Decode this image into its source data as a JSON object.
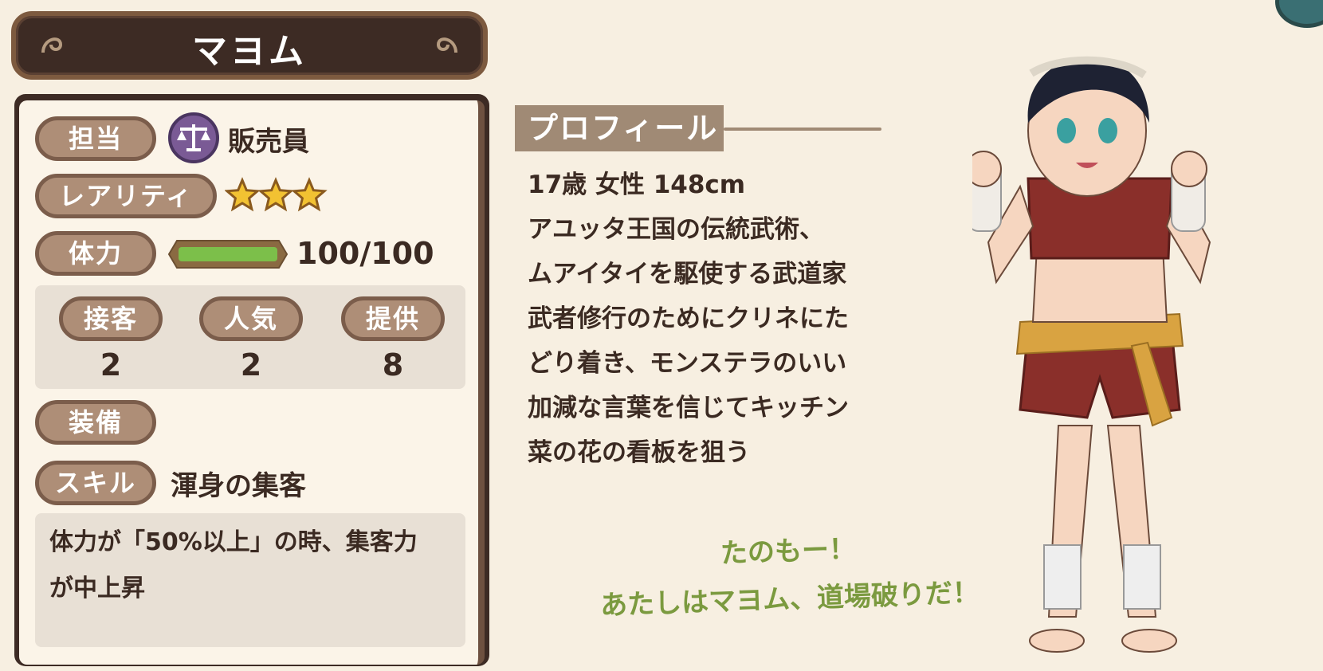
{
  "character": {
    "name": "マヨム"
  },
  "stats_panel": {
    "role_label": "担当",
    "role_value": "販売員",
    "role_icon": "scales-icon",
    "rarity_label": "レアリティ",
    "rarity_stars": 3,
    "hp_label": "体力",
    "hp_text": "100/100",
    "hp_fraction": 1.0,
    "stats": [
      {
        "label": "接客",
        "value": "2"
      },
      {
        "label": "人気",
        "value": "2"
      },
      {
        "label": "提供",
        "value": "8"
      }
    ],
    "equip_label": "装備",
    "skill_label": "スキル",
    "skill_name": "渾身の集客",
    "skill_desc_line1": "体力が「50%以上」の時、集客力",
    "skill_desc_line2": "が中上昇"
  },
  "profile": {
    "heading": "プロフィール",
    "text": "17歳 女性 148cm\nアユッタ王国の伝統武術、\nムアイタイを駆使する武道家\n武者修行のためにクリネにた\nどり着き、モンステラのいい\n加減な言葉を信じてキッチン\n菜の花の看板を狙う"
  },
  "quote": "たのもー！\nあたしはマヨム、道場破りだ！",
  "colors": {
    "frame": "#3d2b24",
    "pill": "#ae8e77",
    "hp_bar": "#7cbf4a",
    "quote": "#7b9a3f"
  }
}
